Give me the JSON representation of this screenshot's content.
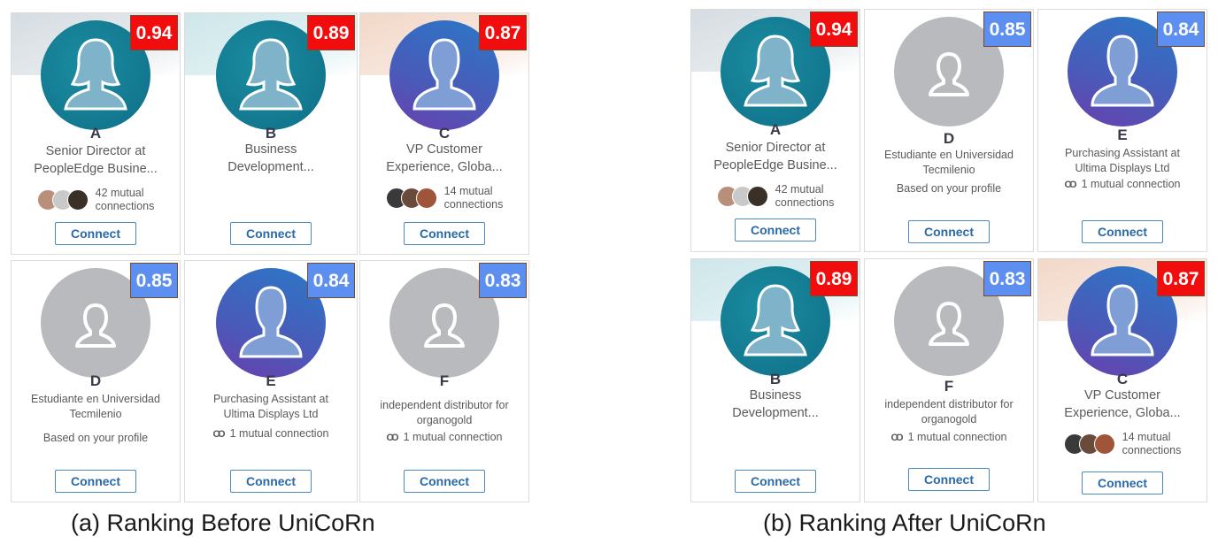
{
  "captions": {
    "before": "(a) Ranking Before UniCoRn",
    "after": "(b) Ranking After UniCoRn"
  },
  "colors": {
    "score_high": "#f10d0d",
    "score_low": "#5c8ff0",
    "connect_text": "#2a6aa8"
  },
  "connect_label": "Connect",
  "people": {
    "A": {
      "letter": "A",
      "score": "0.94",
      "title1": "Senior Director at",
      "title2": "PeopleEdge Busine...",
      "mutual1": "42 mutual",
      "mutual2": "connections"
    },
    "B": {
      "letter": "B",
      "score": "0.89",
      "title1": "Business",
      "title2": "Development..."
    },
    "C": {
      "letter": "C",
      "score": "0.87",
      "title1": "VP Customer",
      "title2": "Experience, Globa...",
      "mutual1": "14 mutual",
      "mutual2": "connections"
    },
    "D": {
      "letter": "D",
      "score": "0.85",
      "title1": "Estudiante en Universidad",
      "title2": "Tecmilenio",
      "sub": "Based on your profile"
    },
    "E": {
      "letter": "E",
      "score": "0.84",
      "title1": "Purchasing Assistant at",
      "title2": "Ultima Displays Ltd",
      "mutual": "1 mutual connection"
    },
    "F": {
      "letter": "F",
      "score": "0.83",
      "title1": "independent distributor for",
      "title2": "organogold",
      "mutual": "1 mutual connection"
    }
  }
}
